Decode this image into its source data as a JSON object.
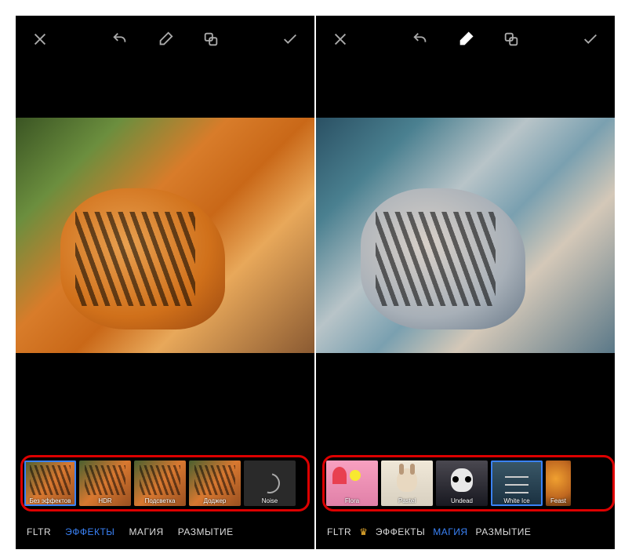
{
  "left": {
    "toolbar": {
      "eraser_active": false
    },
    "thumbs": [
      {
        "label": "Без эффектов",
        "selected": true
      },
      {
        "label": "HDR",
        "selected": false
      },
      {
        "label": "Подсветка",
        "selected": false
      },
      {
        "label": "Доджер",
        "selected": false
      },
      {
        "label": "Noise",
        "selected": false,
        "kind": "noise"
      }
    ],
    "tabs": {
      "fltr": "FLTR",
      "effects": "ЭФФЕКТЫ",
      "magic": "МАГИЯ",
      "blur": "РАЗМЫТИЕ",
      "active": "effects",
      "crown": false
    }
  },
  "right": {
    "toolbar": {
      "eraser_active": true
    },
    "thumbs": [
      {
        "label": "Flora",
        "selected": false,
        "kind": "flora"
      },
      {
        "label": "Pastel",
        "selected": false,
        "kind": "pastel"
      },
      {
        "label": "Undead",
        "selected": false,
        "kind": "undead"
      },
      {
        "label": "White Ice",
        "selected": true,
        "kind": "whiteice"
      },
      {
        "label": "Feast",
        "selected": false,
        "kind": "feast"
      }
    ],
    "tabs": {
      "fltr": "FLTR",
      "effects": "ЭФФЕКТЫ",
      "magic": "МАГИЯ",
      "blur": "РАЗМЫТИЕ",
      "active": "magic",
      "crown": true
    }
  }
}
